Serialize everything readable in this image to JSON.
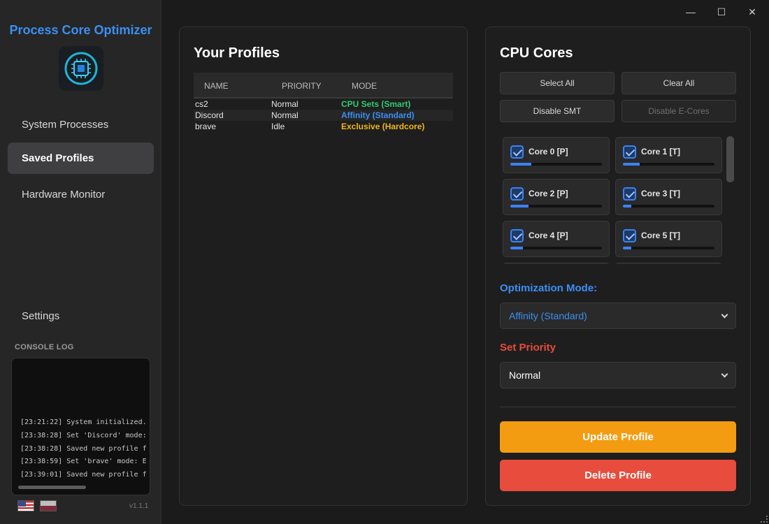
{
  "app": {
    "title": "Process Core Optimizer",
    "version": "v1.1.1"
  },
  "nav": {
    "items": [
      {
        "label": "System Processes"
      },
      {
        "label": "Saved Profiles"
      },
      {
        "label": "Hardware Monitor"
      },
      {
        "label": "Settings"
      }
    ],
    "active_index": 1
  },
  "console": {
    "title": "CONSOLE LOG",
    "lines": [
      "[23:21:22] System initialized.",
      "[23:38:28] Set 'Discord' mode:",
      "[23:38:28] Saved new profile f",
      "[23:38:59] Set 'brave' mode: E",
      "[23:39:01] Saved new profile f"
    ]
  },
  "window": {
    "minimize": "—",
    "maximize": "☐",
    "close": "✕"
  },
  "profiles": {
    "title": "Your Profiles",
    "columns": [
      "NAME",
      "PRIORITY",
      "MODE"
    ],
    "rows": [
      {
        "name": "cs2",
        "priority": "Normal",
        "mode": "CPU Sets (Smart)",
        "mode_color": "#2ecc71"
      },
      {
        "name": "Discord",
        "priority": "Normal",
        "mode": "Affinity (Standard)",
        "mode_color": "#3b8ff3"
      },
      {
        "name": "brave",
        "priority": "Idle",
        "mode": "Exclusive (Hardcore)",
        "mode_color": "#f1b51c"
      }
    ]
  },
  "cpu": {
    "title": "CPU Cores",
    "buttons": {
      "select_all": "Select All",
      "clear_all": "Clear All",
      "disable_smt": "Disable SMT",
      "disable_ecores": "Disable E-Cores"
    },
    "cores": [
      {
        "label": "Core 0 [P]",
        "checked": true,
        "usage": 0.23
      },
      {
        "label": "Core 1 [T]",
        "checked": true,
        "usage": 0.18
      },
      {
        "label": "Core 2 [P]",
        "checked": true,
        "usage": 0.2
      },
      {
        "label": "Core 3 [T]",
        "checked": true,
        "usage": 0.09
      },
      {
        "label": "Core 4 [P]",
        "checked": true,
        "usage": 0.14
      },
      {
        "label": "Core 5 [T]",
        "checked": true,
        "usage": 0.09
      }
    ]
  },
  "optimization": {
    "label": "Optimization Mode:",
    "label_color": "#3b8ff3",
    "value": "Affinity (Standard)",
    "value_color": "#3b8ff3"
  },
  "priority": {
    "label": "Set Priority",
    "label_color": "#e74c3c",
    "value": "Normal"
  },
  "actions": {
    "update": {
      "label": "Update Profile",
      "color": "#f39c12"
    },
    "delete": {
      "label": "Delete Profile",
      "color": "#e74c3c"
    }
  }
}
